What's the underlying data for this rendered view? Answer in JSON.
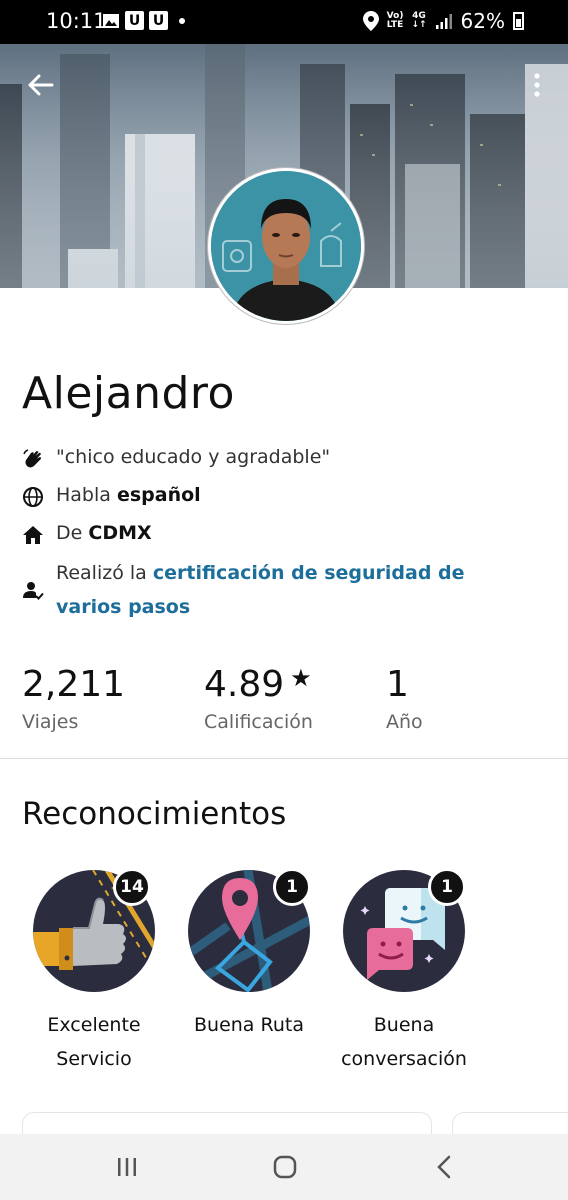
{
  "status_bar": {
    "time": "10:11",
    "notif_icons": [
      "image-icon",
      "u-app-icon",
      "u-app-icon"
    ],
    "net_top": "Vo)",
    "net_bottom": "LTE",
    "signal_label": "4G",
    "battery": "62%"
  },
  "header": {
    "back_icon": "arrow-left-icon",
    "menu_icon": "more-vertical-icon"
  },
  "profile": {
    "name": "Alejandro",
    "quote": "\"chico educado y agradable\"",
    "language_prefix": "Habla",
    "language": "español",
    "from_prefix": "De",
    "from": "CDMX",
    "cert_prefix": "Realizó la",
    "cert_link": "certificación de seguridad de varios pasos"
  },
  "stats": [
    {
      "value": "2,211",
      "label": "Viajes"
    },
    {
      "value": "4.89",
      "label": "Calificación",
      "suffix": "★"
    },
    {
      "value": "1",
      "label": "Año"
    }
  ],
  "recognitions": {
    "title": "Reconocimientos",
    "items": [
      {
        "line1": "Excelente",
        "line2": "Servicio",
        "count": "14",
        "icon": "thumbs-up-icon"
      },
      {
        "line1": "Buena Ruta",
        "line2": "",
        "count": "1",
        "icon": "map-pin-icon"
      },
      {
        "line1": "Buena",
        "line2": "conversación",
        "count": "1",
        "icon": "chat-bubbles-icon"
      }
    ]
  },
  "colors": {
    "link": "#1d6e9a",
    "badge_bg": "#2b2d3e",
    "status_bar": "#000000"
  },
  "nav": [
    "recent-apps-icon",
    "home-icon",
    "back-icon"
  ]
}
